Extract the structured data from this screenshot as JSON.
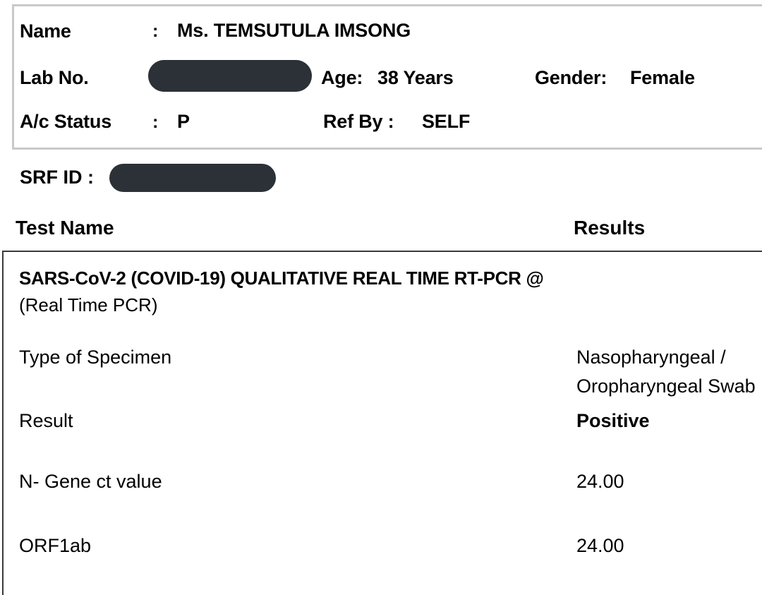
{
  "document": {
    "type": "lab-report",
    "colors": {
      "redaction": "#2B3137",
      "demo_box_border": "#C9C9C9",
      "table_box_border": "#3A3A3A",
      "page_background": "#FFFFFF",
      "text": "#000000"
    }
  },
  "patient": {
    "name_label": "Name",
    "name_colon": ":",
    "name_value": "Ms. TEMSUTULA  IMSONG",
    "lab_no_label": "Lab No.",
    "lab_no_colon": ":",
    "lab_no_value": "",
    "lab_no_redacted": true,
    "age_label": "Age:",
    "age_value": "38 Years",
    "gender_label": "Gender:",
    "gender_value": "Female",
    "ac_status_label": "A/c Status",
    "ac_status_colon": ":",
    "ac_status_value": "P",
    "ref_by_label": "Ref By :",
    "ref_by_value": "SELF"
  },
  "srf": {
    "label": "SRF ID :",
    "value": "",
    "redacted": true
  },
  "table": {
    "headers": {
      "test_name": "Test Name",
      "results": "Results"
    },
    "test_title": "SARS-CoV-2 (COVID-19) QUALITATIVE  REAL TIME  RT-PCR  @",
    "test_subtitle": "(Real Time PCR)",
    "rows": [
      {
        "name": "Type of Specimen",
        "value_line1": "Nasopharyngeal /",
        "value_line2": "Oropharyngeal Swab",
        "bold_value": false
      },
      {
        "name": "Result",
        "value_line1": "Positive",
        "bold_value": true
      },
      {
        "name": "N- Gene ct value",
        "value_line1": "24.00",
        "bold_value": false
      },
      {
        "name": "ORF1ab",
        "value_line1": "24.00",
        "bold_value": false
      }
    ]
  }
}
